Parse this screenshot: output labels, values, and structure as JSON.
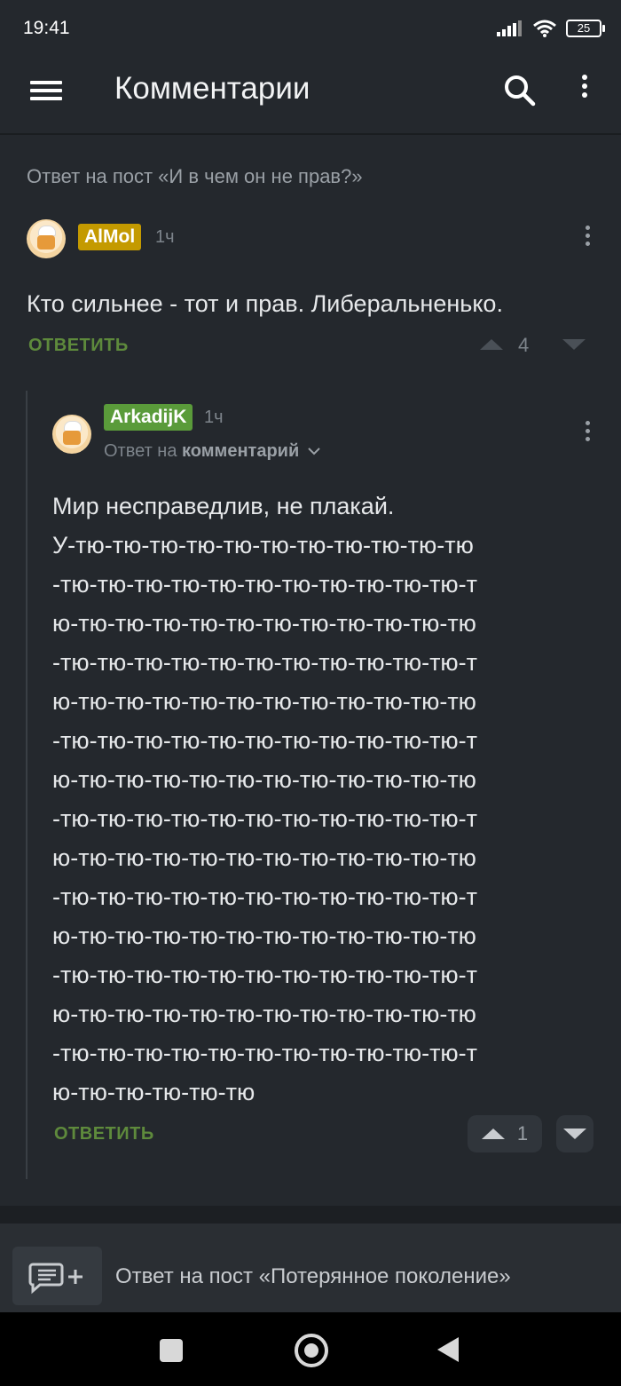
{
  "status_bar": {
    "time": "19:41",
    "battery": "25"
  },
  "app_bar": {
    "title": "Комментарии"
  },
  "thread": {
    "post_ref": "Ответ на пост «И в чем он не прав?»",
    "comment1": {
      "author": "AlMol",
      "author_color": "#c49a00",
      "time": "1ч",
      "text": "Кто сильнее - тот и прав. Либеральненько.",
      "reply_label": "ОТВЕТИТЬ",
      "rating": "4"
    },
    "comment2": {
      "author": "ArkadijK",
      "author_color": "#5a9b3a",
      "time": "1ч",
      "reply_to_prefix": "Ответ на",
      "reply_to_target": "комментарий",
      "text_lines": [
        "Мир несправедлив, не плакай.",
        "У-тю-тю-тю-тю-тю-тю-тю-тю-тю-тю-тю",
        "-тю-тю-тю-тю-тю-тю-тю-тю-тю-тю-тю-т",
        "ю-тю-тю-тю-тю-тю-тю-тю-тю-тю-тю-тю",
        "-тю-тю-тю-тю-тю-тю-тю-тю-тю-тю-тю-т",
        "ю-тю-тю-тю-тю-тю-тю-тю-тю-тю-тю-тю",
        "-тю-тю-тю-тю-тю-тю-тю-тю-тю-тю-тю-т",
        "ю-тю-тю-тю-тю-тю-тю-тю-тю-тю-тю-тю",
        "-тю-тю-тю-тю-тю-тю-тю-тю-тю-тю-тю-т",
        "ю-тю-тю-тю-тю-тю-тю-тю-тю-тю-тю-тю",
        "-тю-тю-тю-тю-тю-тю-тю-тю-тю-тю-тю-т",
        "ю-тю-тю-тю-тю-тю-тю-тю-тю-тю-тю-тю",
        "-тю-тю-тю-тю-тю-тю-тю-тю-тю-тю-тю-т",
        "ю-тю-тю-тю-тю-тю-тю-тю-тю-тю-тю-тю",
        "-тю-тю-тю-тю-тю-тю-тю-тю-тю-тю-тю-т",
        "ю-тю-тю-тю-тю-тю"
      ],
      "reply_label": "ОТВЕТИТЬ",
      "rating": "1"
    }
  },
  "bottom": {
    "post_ref": "Ответ на пост «Потерянное поколение»"
  },
  "colors": {
    "accent_green": "#5e8a3c",
    "background": "#24282d"
  },
  "icons": [
    "menu-icon",
    "search-icon",
    "more-vert-icon",
    "chevron-down-icon",
    "add-comment-icon",
    "arrow-up-icon",
    "arrow-down-icon"
  ]
}
